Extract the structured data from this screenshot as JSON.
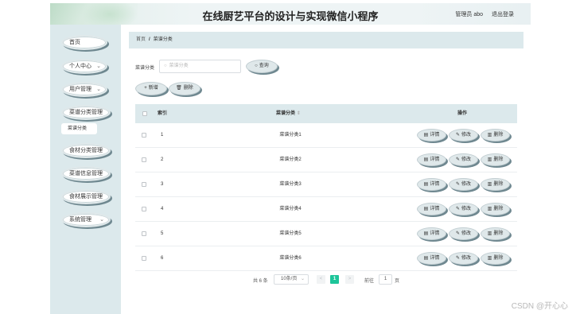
{
  "header": {
    "title": "在线厨艺平台的设计与实现微信小程序",
    "user": "管理员 abo",
    "logout": "退出登录"
  },
  "sidebar": {
    "items": [
      {
        "label": "首页",
        "has_children": false
      },
      {
        "label": "个人中心",
        "has_children": true
      },
      {
        "label": "用户管理",
        "has_children": true
      },
      {
        "label": "菜谱分类管理",
        "has_children": true
      },
      {
        "label": "食材分类管理",
        "has_children": true
      },
      {
        "label": "菜谱信息管理",
        "has_children": true
      },
      {
        "label": "食材展示管理",
        "has_children": true
      },
      {
        "label": "系统管理",
        "has_children": true
      }
    ],
    "active_sub": "菜谱分类",
    "chevron": "⌄"
  },
  "breadcrumb": {
    "home": "首页",
    "separator": "/",
    "current": "菜谱分类"
  },
  "search": {
    "label": "菜谱分类",
    "placeholder": "菜谱分类",
    "button": "查询"
  },
  "toolbar": {
    "add": "新增",
    "delete": "删除"
  },
  "table": {
    "columns": {
      "index": "索引",
      "name": "菜谱分类",
      "actions": "操作"
    },
    "rows": [
      {
        "index": "1",
        "name": "菜谱分类1"
      },
      {
        "index": "2",
        "name": "菜谱分类2"
      },
      {
        "index": "3",
        "name": "菜谱分类3"
      },
      {
        "index": "4",
        "name": "菜谱分类4"
      },
      {
        "index": "5",
        "name": "菜谱分类5"
      },
      {
        "index": "6",
        "name": "菜谱分类6"
      }
    ],
    "action_labels": {
      "detail": "详情",
      "edit": "修改",
      "delete": "删除"
    }
  },
  "pagination": {
    "total": "共 6 条",
    "page_size": "10条/页",
    "prev": "<",
    "current_page": "1",
    "next": ">",
    "goto_label": "前往",
    "goto_value": "1",
    "page_suffix": "页"
  },
  "watermark": "CSDN @开心心",
  "colors": {
    "accent": "#1ec59a",
    "sidebar_bg": "#dce9ec",
    "pill_bg": "#dfe8ea",
    "pill_shadow": "#6f8890"
  }
}
